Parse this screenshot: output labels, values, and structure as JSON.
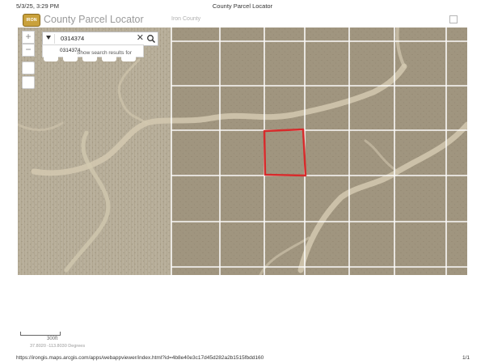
{
  "print": {
    "datetime": "5/3/25, 3:29 PM",
    "title": "County Parcel Locator",
    "url": "https://irongis.maps.arcgis.com/apps/webappviewer/index.html?id=4b8e40e3c17d45d282a2b1515fbdd160",
    "page": "1/1"
  },
  "app": {
    "logo_text": "IRON",
    "title": "County Parcel Locator",
    "subtitle": "Iron County"
  },
  "search": {
    "value": "0314374",
    "suggestion_prefix": "Show search results for",
    "suggestion_value": "0314374"
  },
  "zoom": {
    "in": "+",
    "out": "−"
  },
  "scale": {
    "label": "300ft"
  },
  "coordinates": "37.8020 -113.8030 Degrees",
  "icons": [
    "chevron-down-icon",
    "close-icon",
    "search-icon",
    "expand-icon"
  ],
  "colors": {
    "highlight": "#d62b2b",
    "parcel_lines": "#ffffff",
    "map_land": "#b5a993"
  }
}
